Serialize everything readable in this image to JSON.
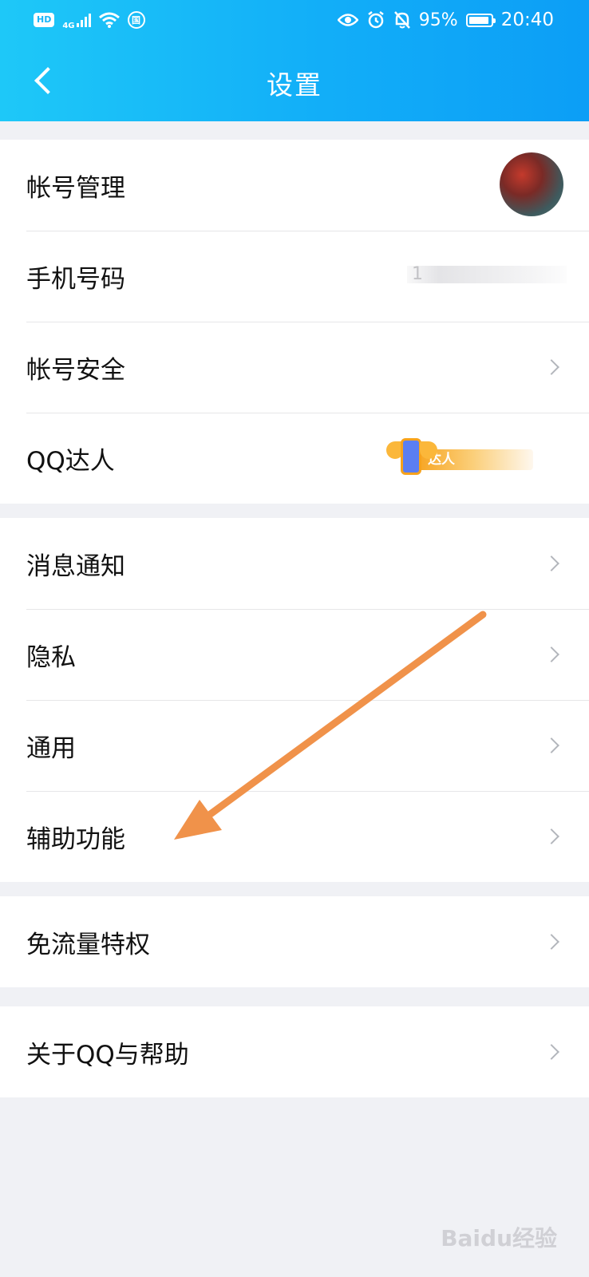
{
  "status_bar": {
    "hd": "HD",
    "network": "4G",
    "sim_icon": "国",
    "battery": "95%",
    "time": "20:40"
  },
  "nav": {
    "title": "设置",
    "back_icon": "chevron-left-icon"
  },
  "groups": [
    {
      "items": [
        {
          "label": "帐号管理"
        },
        {
          "label": "手机号码",
          "value": "1"
        },
        {
          "label": "帐号安全"
        },
        {
          "label": "QQ达人",
          "badge": "达人"
        }
      ]
    },
    {
      "items": [
        {
          "label": "消息通知"
        },
        {
          "label": "隐私"
        },
        {
          "label": "通用"
        },
        {
          "label": "辅助功能"
        }
      ]
    },
    {
      "items": [
        {
          "label": "免流量特权"
        }
      ]
    },
    {
      "items": [
        {
          "label": "关于QQ与帮助"
        }
      ]
    }
  ],
  "annotation_color": "#f0924a",
  "watermark": "Baidu经验"
}
